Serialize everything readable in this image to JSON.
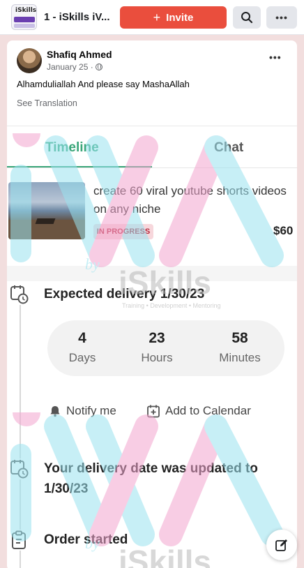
{
  "header": {
    "group_thumb_text": "iSkills",
    "group_title": "1 - iSkills iV...",
    "invite_label": "Invite"
  },
  "post": {
    "author": "Shafiq Ahmed",
    "date": "January 25 ·",
    "text": "Alhamduliallah And please say MashaAllah",
    "see_translation": "See Translation"
  },
  "app": {
    "tabs": [
      {
        "label": "Timeline",
        "active": true
      },
      {
        "label": "Chat",
        "active": false
      }
    ],
    "order": {
      "title": "create 60 viral youtube shorts videos on any niche",
      "status": "IN PROGRESS",
      "price": "$60"
    },
    "timeline": [
      {
        "title": "Expected delivery 1/30/23",
        "icon": "calendar-clock-icon"
      },
      {
        "title": "Your delivery date was updated to 1/30/23",
        "icon": "calendar-clock-icon"
      },
      {
        "title": "Order started",
        "icon": "clipboard-icon"
      }
    ],
    "countdown": [
      {
        "value": "4",
        "label": "Days"
      },
      {
        "value": "23",
        "label": "Hours"
      },
      {
        "value": "58",
        "label": "Minutes"
      }
    ],
    "actions": {
      "notify": "Notify me",
      "calendar": "Add to Calendar"
    }
  },
  "watermark": {
    "by": "by",
    "brand": "iSkills",
    "tagline": "Training • Development • Mentoring"
  },
  "colors": {
    "invite": "#ea4e3d",
    "timeline_accent": "#3aa679",
    "badge_text": "#b3263a"
  }
}
